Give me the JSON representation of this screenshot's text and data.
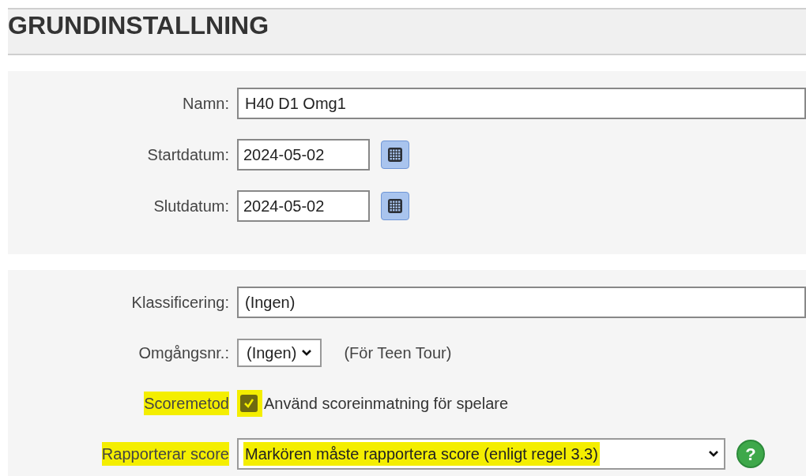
{
  "title": "GRUNDINSTALLNING",
  "panel_1": {
    "rows": [
      {
        "kind": "text",
        "label": "Namn:",
        "value": "H40 D1 Omg1",
        "highlighted": false
      },
      {
        "kind": "date",
        "label": "Startdatum:",
        "value": "2024-05-02",
        "highlighted": false
      },
      {
        "kind": "date",
        "label": "Slutdatum:",
        "value": "2024-05-02",
        "highlighted": false
      }
    ]
  },
  "panel_2": {
    "rows": [
      {
        "kind": "text",
        "label": "Klassificering:",
        "value": "(Ingen)",
        "highlighted": false
      },
      {
        "kind": "select",
        "label": "Omgångsnr.:",
        "value": "(Ingen)",
        "note": "(För Teen Tour)",
        "highlighted": false
      },
      {
        "kind": "checkbox",
        "label": "Scoremetod",
        "checked": true,
        "text": "Använd scoreinmatning för spelare",
        "highlighted": true
      },
      {
        "kind": "wide-select",
        "label": "Rapporterar score",
        "value": "Markören måste rapportera score (enligt regel 3.3)",
        "help": "?",
        "highlighted": true
      }
    ]
  }
}
